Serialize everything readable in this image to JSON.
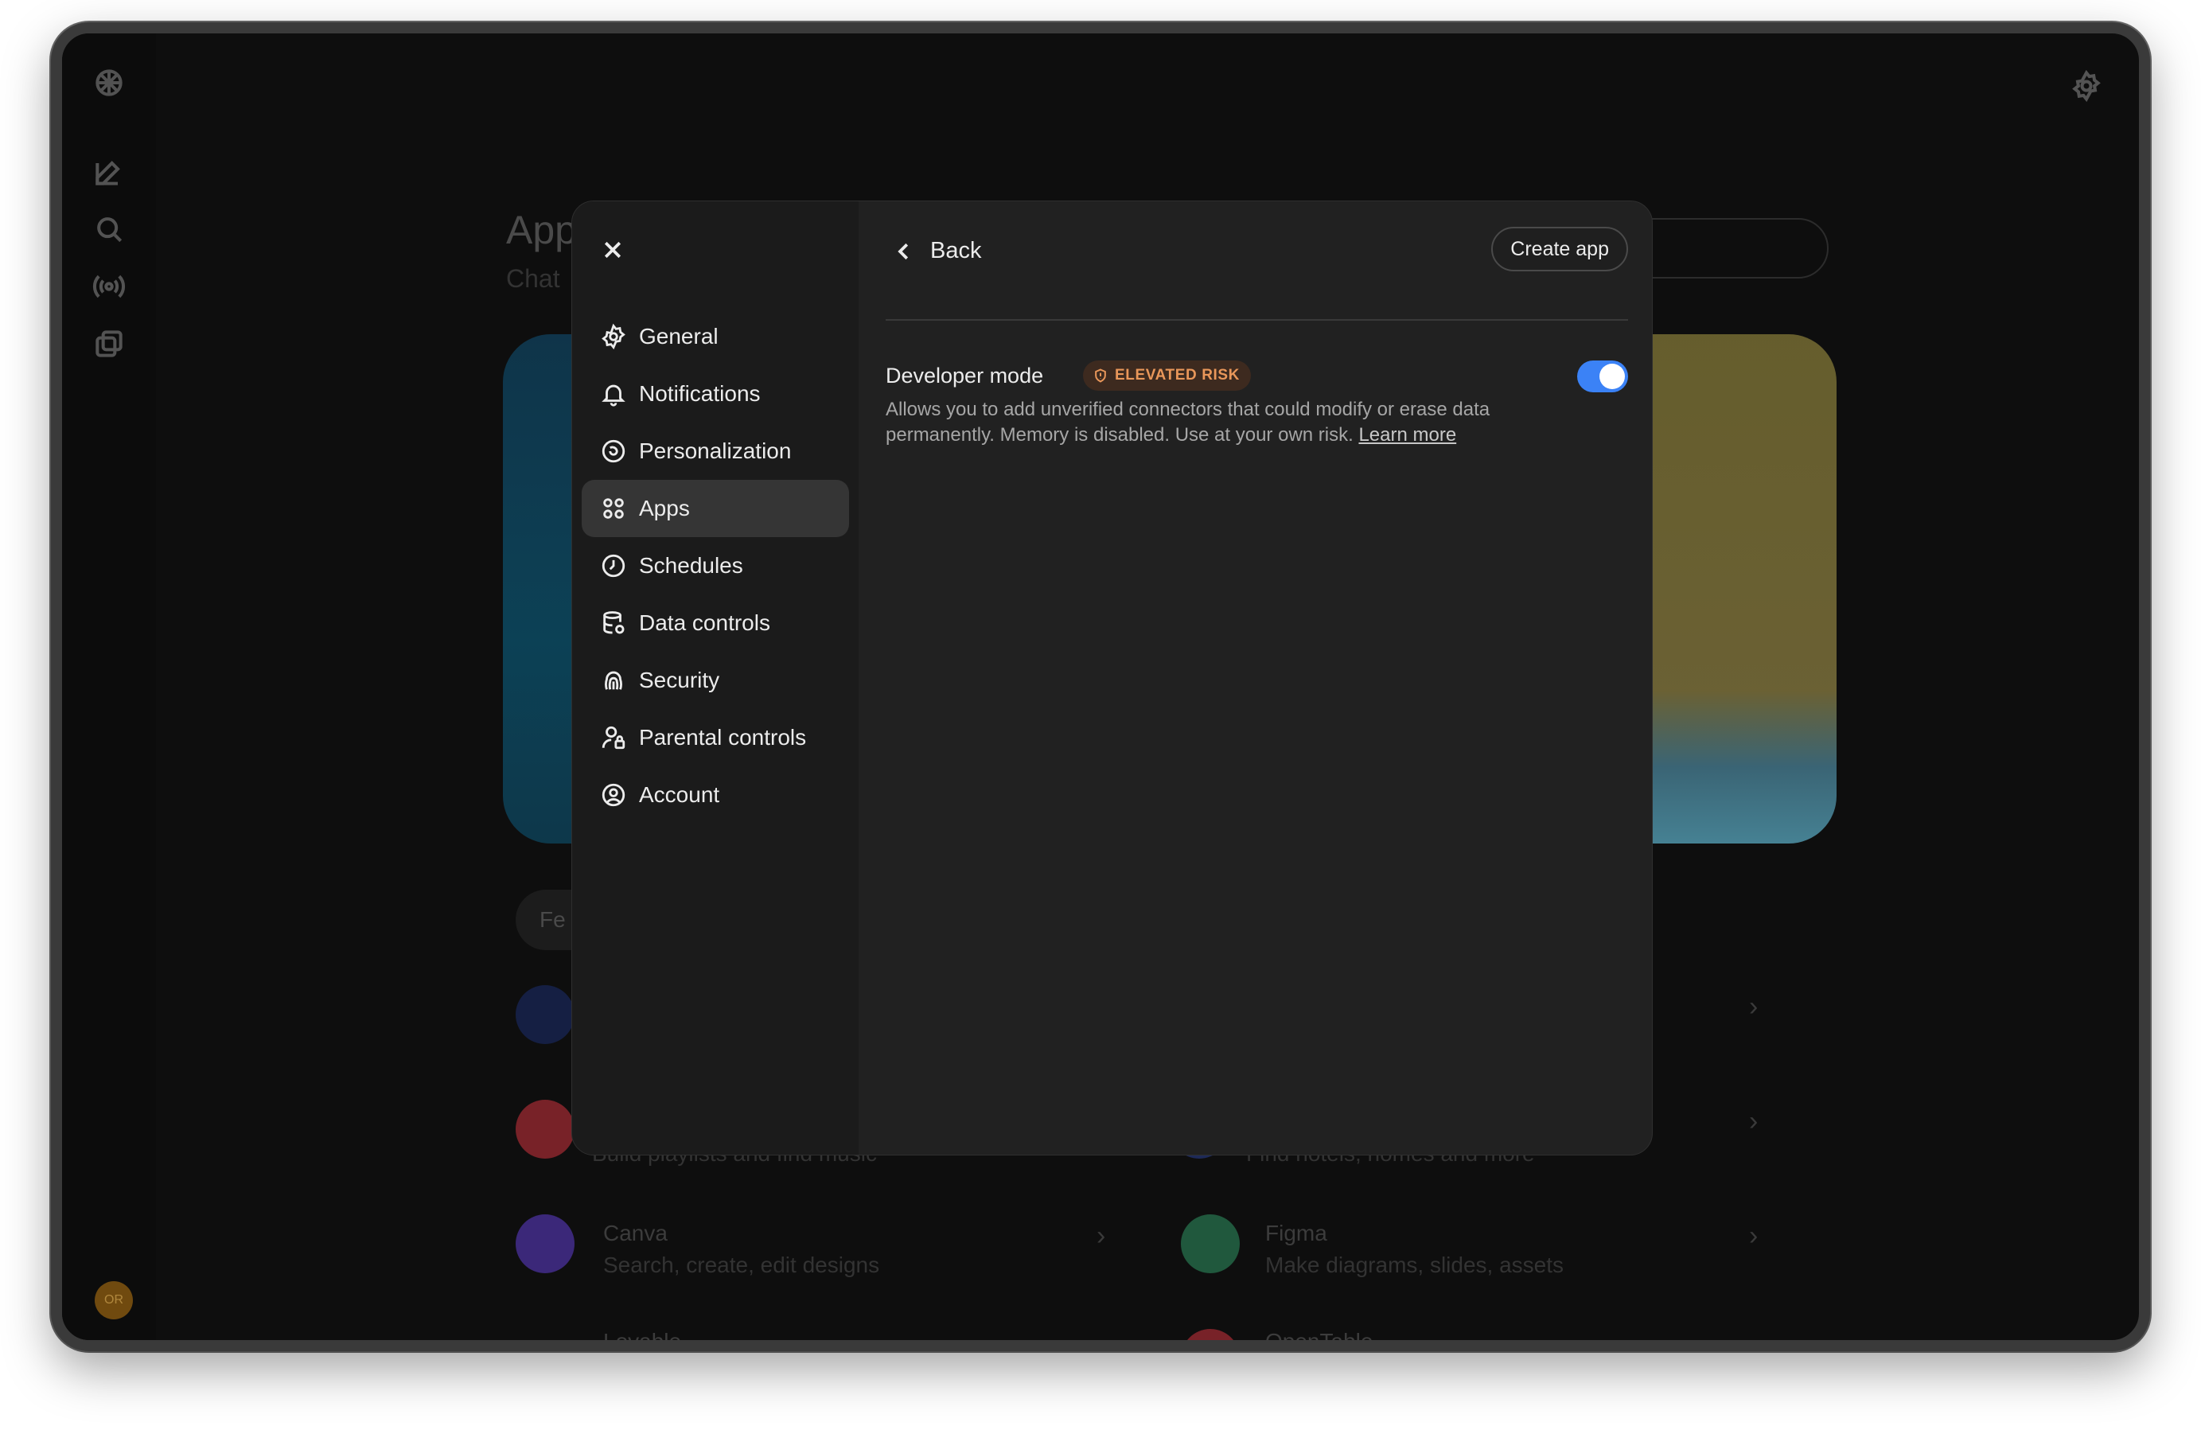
{
  "background": {
    "title": "App",
    "subtitle": "Chat",
    "chip": "Fe",
    "rows": [
      {
        "name": "",
        "desc": "Build playlists and find music",
        "color": "#c0303a"
      },
      {
        "name": "",
        "desc": "Find hotels, homes and more",
        "color": "#2a3e8a"
      },
      {
        "name": "Canva",
        "desc": "Search, create, edit designs",
        "color": "#5a3bc2"
      },
      {
        "name": "Figma",
        "desc": "Make diagrams, slides, assets",
        "color": "#2d8a5e"
      },
      {
        "name": "Lovable",
        "desc": "",
        "color": "#2a2a2a"
      },
      {
        "name": "OpenTable",
        "desc": "",
        "color": "#c0303a"
      }
    ],
    "avatar_initials": "OR"
  },
  "modal": {
    "nav": [
      {
        "label": "General",
        "icon": "gear-icon"
      },
      {
        "label": "Notifications",
        "icon": "bell-icon"
      },
      {
        "label": "Personalization",
        "icon": "personalization-icon"
      },
      {
        "label": "Apps",
        "icon": "apps-grid-icon",
        "active": true
      },
      {
        "label": "Schedules",
        "icon": "clock-icon"
      },
      {
        "label": "Data controls",
        "icon": "database-icon"
      },
      {
        "label": "Security",
        "icon": "fingerprint-icon"
      },
      {
        "label": "Parental controls",
        "icon": "parental-icon"
      },
      {
        "label": "Account",
        "icon": "account-icon"
      }
    ],
    "back_label": "Back",
    "create_app_label": "Create app",
    "developer_mode": {
      "title": "Developer mode",
      "badge": "ELEVATED RISK",
      "enabled": true,
      "description": "Allows you to add unverified connectors that could modify or erase data permanently. Memory is disabled. Use at your own risk.",
      "learn_more": "Learn more"
    }
  },
  "colors": {
    "toggle_on": "#3b82f6",
    "badge_text": "#e9975a",
    "badge_bg": "#3d2a1f"
  }
}
